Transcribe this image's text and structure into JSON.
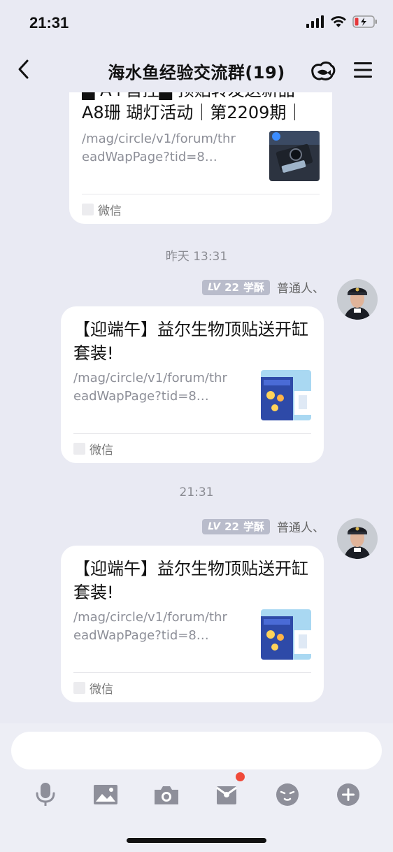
{
  "status_bar": {
    "time": "21:31",
    "signal_icon": "cellular-signal-icon",
    "wifi_icon": "wifi-icon",
    "battery_icon": "battery-low-charging-icon"
  },
  "header": {
    "title": "海水鱼经验交流群(19)",
    "back_icon": "chevron-left-icon",
    "pet_icon": "fish-cloud-icon",
    "menu_icon": "hamburger-menu-icon"
  },
  "messages": [
    {
      "title": "A8珊 瑚灯活动｜第2209期｜",
      "title_partial_top": "▆ A+首控▆ 预贴转发送新品",
      "link": "/mag/circle/v1/forum/threadWapPage?tid=8…",
      "source": "微信"
    },
    {
      "timestamp": "昨天 13:31",
      "badge_level": "LV",
      "badge_num": "22",
      "badge_title": "学酥",
      "sender": "普通人、",
      "title": "【迎端午】益尔生物顶贴送开缸套装!",
      "link": "/mag/circle/v1/forum/threadWapPage?tid=8…",
      "source": "微信"
    },
    {
      "timestamp": "21:31",
      "badge_level": "LV",
      "badge_num": "22",
      "badge_title": "学酥",
      "sender": "普通人、",
      "title": "【迎端午】益尔生物顶贴送开缸套装!",
      "link": "/mag/circle/v1/forum/threadWapPage?tid=8…",
      "source": "微信"
    }
  ],
  "input": {
    "placeholder": ""
  },
  "toolbar": [
    {
      "icon": "microphone-icon"
    },
    {
      "icon": "image-icon"
    },
    {
      "icon": "camera-icon"
    },
    {
      "icon": "red-packet-icon",
      "has_dot": true
    },
    {
      "icon": "emoji-icon"
    },
    {
      "icon": "plus-circle-icon"
    }
  ],
  "colors": {
    "background": "#e9eaf3",
    "card": "#ffffff",
    "badge": "#b9bccb",
    "notification_dot": "#f04a3a",
    "icon_gray": "#8e8f9a"
  }
}
